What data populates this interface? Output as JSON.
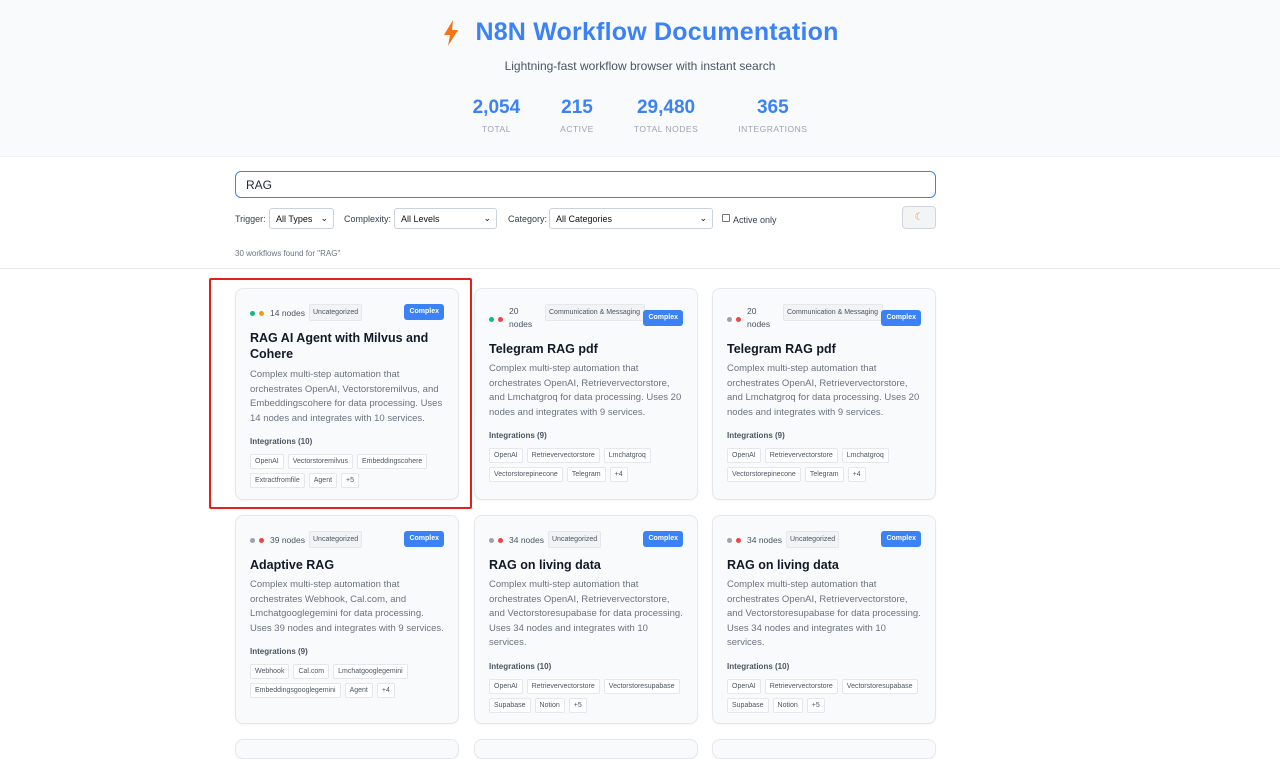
{
  "header": {
    "icon": "lightning-bolt-icon",
    "title": "N8N Workflow Documentation",
    "subtitle": "Lightning-fast workflow browser with instant search"
  },
  "stats": [
    {
      "value": "2,054",
      "label": "TOTAL"
    },
    {
      "value": "215",
      "label": "ACTIVE"
    },
    {
      "value": "29,480",
      "label": "TOTAL NODES"
    },
    {
      "value": "365",
      "label": "INTEGRATIONS"
    }
  ],
  "search": {
    "value": "RAG"
  },
  "filters": {
    "trigger_label": "Trigger:",
    "trigger_value": "All Types",
    "complexity_label": "Complexity:",
    "complexity_value": "All Levels",
    "category_label": "Category:",
    "category_value": "All Categories",
    "active_only_label": "Active only",
    "theme_icon": "moon-icon"
  },
  "results_text": "30 workflows found for \"RAG\"",
  "colors": {
    "accent": "#3b82f6",
    "highlight": "#e0221e"
  },
  "cards": [
    {
      "dots": [
        "#10b981",
        "#f59e0b"
      ],
      "nodes": "14 nodes",
      "category": "Uncategorized",
      "badge": "Complex",
      "title": "RAG AI Agent with Milvus and Cohere",
      "description": "Complex multi-step automation that orchestrates OpenAI, Vectorstoremilvus, and Embeddingscohere for data processing. Uses 14 nodes and integrates with 10 services.",
      "integrations_label": "Integrations (10)",
      "tags": [
        "OpenAI",
        "Vectorstoremilvus",
        "Embeddingscohere",
        "Extractfromfile",
        "Agent",
        "+5"
      ]
    },
    {
      "dots": [
        "#10b981",
        "#ef4444"
      ],
      "nodes": "20 nodes",
      "category": "Communication & Messaging",
      "badge": "Complex",
      "title": "Telegram RAG pdf",
      "description": "Complex multi-step automation that orchestrates OpenAI, Retrievervectorstore, and Lmchatgroq for data processing. Uses 20 nodes and integrates with 9 services.",
      "integrations_label": "Integrations (9)",
      "tags": [
        "OpenAI",
        "Retrievervectorstore",
        "Lmchatgroq",
        "Vectorstorepinecone",
        "Telegram",
        "+4"
      ]
    },
    {
      "dots": [
        "#9ca3af",
        "#ef4444"
      ],
      "nodes": "20 nodes",
      "category": "Communication & Messaging",
      "badge": "Complex",
      "title": "Telegram RAG pdf",
      "description": "Complex multi-step automation that orchestrates OpenAI, Retrievervectorstore, and Lmchatgroq for data processing. Uses 20 nodes and integrates with 9 services.",
      "integrations_label": "Integrations (9)",
      "tags": [
        "OpenAI",
        "Retrievervectorstore",
        "Lmchatgroq",
        "Vectorstorepinecone",
        "Telegram",
        "+4"
      ]
    },
    {
      "dots": [
        "#9ca3af",
        "#ef4444"
      ],
      "nodes": "39 nodes",
      "category": "Uncategorized",
      "badge": "Complex",
      "title": "Adaptive RAG",
      "description": "Complex multi-step automation that orchestrates Webhook, Cal.com, and Lmchatgooglegemini for data processing. Uses 39 nodes and integrates with 9 services.",
      "integrations_label": "Integrations (9)",
      "tags": [
        "Webhook",
        "Cal.com",
        "Lmchatgooglegemini",
        "Embeddingsgooglegemini",
        "Agent",
        "+4"
      ]
    },
    {
      "dots": [
        "#9ca3af",
        "#ef4444"
      ],
      "nodes": "34 nodes",
      "category": "Uncategorized",
      "badge": "Complex",
      "title": "RAG on living data",
      "description": "Complex multi-step automation that orchestrates OpenAI, Retrievervectorstore, and Vectorstoresupabase for data processing. Uses 34 nodes and integrates with 10 services.",
      "integrations_label": "Integrations (10)",
      "tags": [
        "OpenAI",
        "Retrievervectorstore",
        "Vectorstoresupabase",
        "Supabase",
        "Notion",
        "+5"
      ]
    },
    {
      "dots": [
        "#9ca3af",
        "#ef4444"
      ],
      "nodes": "34 nodes",
      "category": "Uncategorized",
      "badge": "Complex",
      "title": "RAG on living data",
      "description": "Complex multi-step automation that orchestrates OpenAI, Retrievervectorstore, and Vectorstoresupabase for data processing. Uses 34 nodes and integrates with 10 services.",
      "integrations_label": "Integrations (10)",
      "tags": [
        "OpenAI",
        "Retrievervectorstore",
        "Vectorstoresupabase",
        "Supabase",
        "Notion",
        "+5"
      ]
    }
  ]
}
